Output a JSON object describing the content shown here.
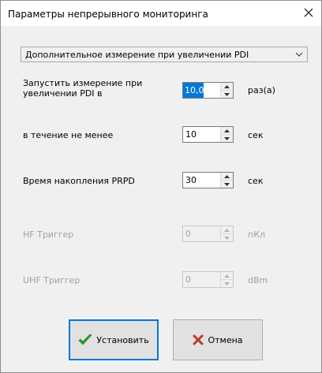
{
  "window": {
    "title": "Параметры непрерывного мониторинга",
    "close_glyph": "✕"
  },
  "mode_select": {
    "selected": "Дополнительное измерение при увеличении PDI"
  },
  "fields": [
    {
      "label_line1": "Запустить измерение при",
      "label_line2": "увеличении PDI в",
      "value": "10,0",
      "unit": "раз(а)",
      "enabled": true
    },
    {
      "label": "в течение не менее",
      "value": "10",
      "unit": "сек",
      "enabled": true
    },
    {
      "label": "Время накопления PRPD",
      "value": "30",
      "unit": "сек",
      "enabled": true
    },
    {
      "label": "HF  Триггер",
      "value": "0",
      "unit": "пКл",
      "enabled": false
    },
    {
      "label": "UHF Триггер",
      "value": "0",
      "unit": "dBm",
      "enabled": false
    }
  ],
  "buttons": {
    "ok_label": "Установить",
    "cancel_label": "Отмена"
  },
  "colors": {
    "accent": "#0078d7",
    "ok_icon": "#2e9e2e",
    "cancel_icon": "#c0392b",
    "disabled_text": "#a0a0a0"
  },
  "icons": {
    "close": "close-icon",
    "dropdown": "chevron-down-icon",
    "spin_up": "spin-up-icon",
    "spin_down": "spin-down-icon",
    "ok": "checkmark-icon",
    "cancel": "cross-icon"
  }
}
